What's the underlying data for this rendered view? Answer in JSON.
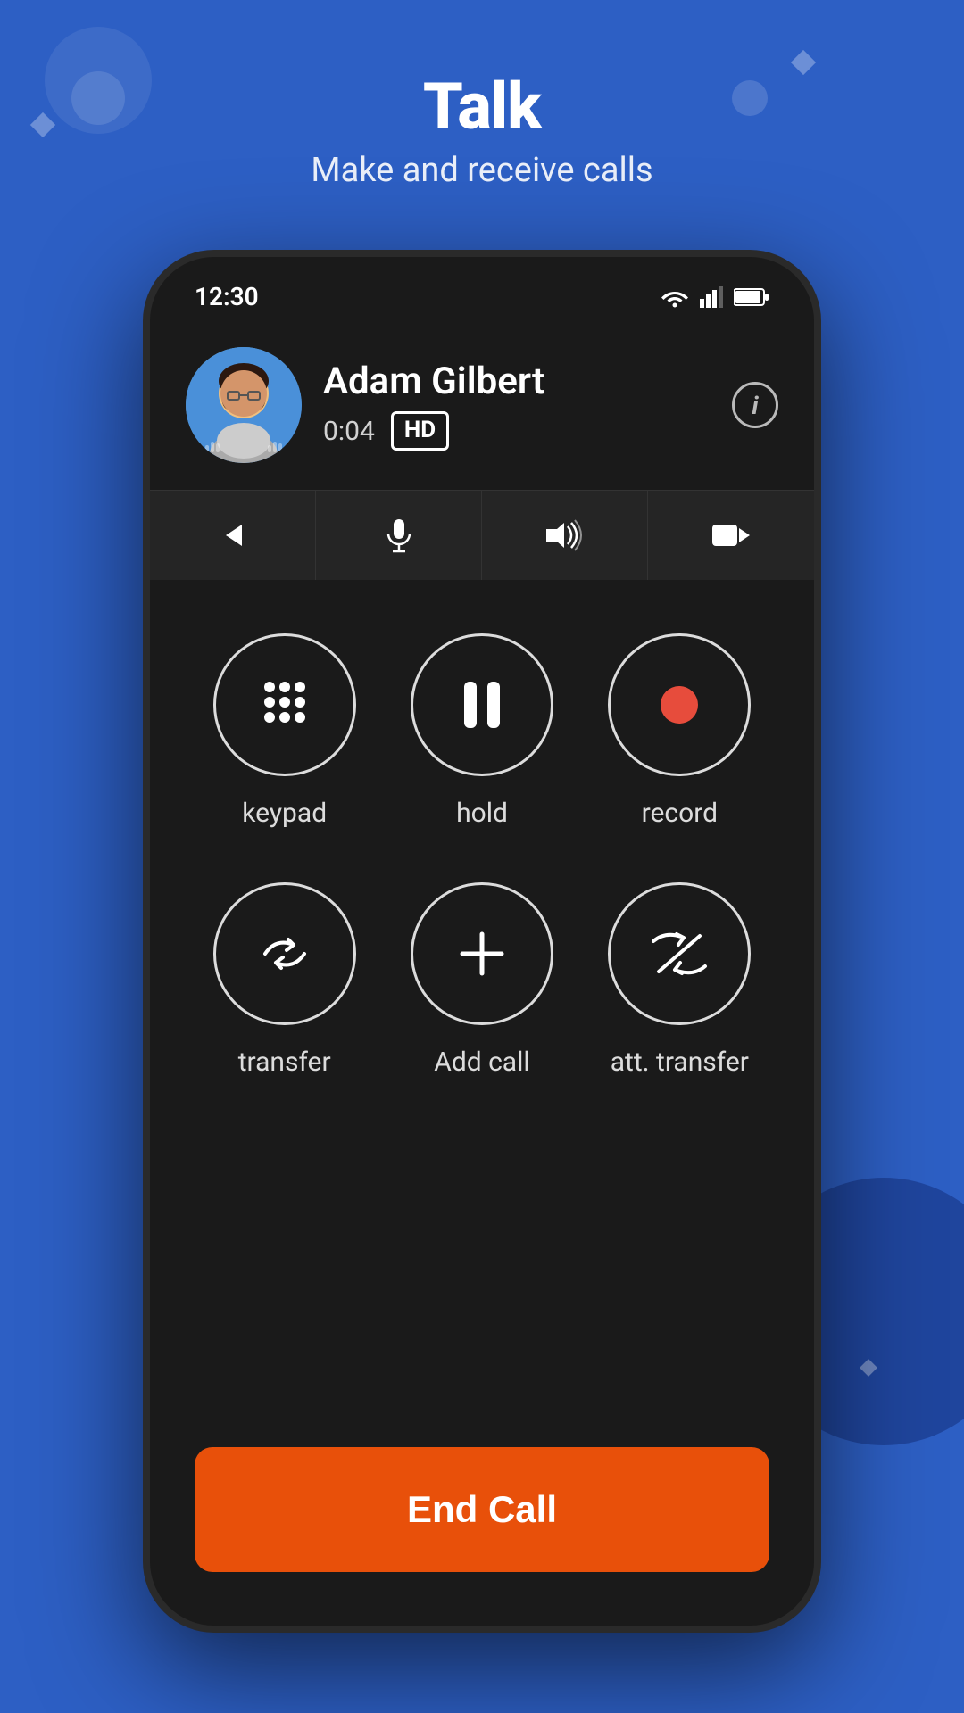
{
  "background": {
    "color": "#2d5fc4"
  },
  "header": {
    "title": "Talk",
    "subtitle": "Make and receive calls"
  },
  "phone": {
    "status_bar": {
      "time": "12:30"
    },
    "call_info": {
      "caller_name": "Adam Gilbert",
      "duration": "0:04",
      "hd_label": "HD"
    },
    "toolbar": {
      "back_label": "back",
      "mute_label": "mute",
      "speaker_label": "speaker",
      "video_label": "video"
    },
    "controls": {
      "keypad_label": "keypad",
      "hold_label": "hold",
      "record_label": "record",
      "transfer_label": "transfer",
      "add_call_label": "Add call",
      "att_transfer_label": "att. transfer"
    },
    "end_call": {
      "label": "End Call"
    }
  }
}
